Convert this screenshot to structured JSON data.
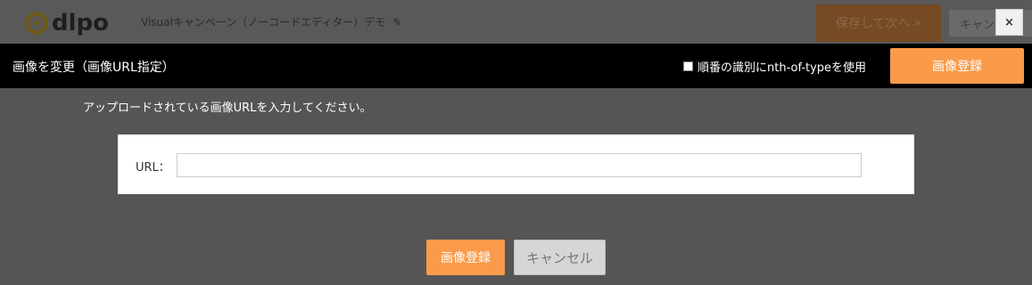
{
  "header": {
    "logo_text": "dlpo",
    "project_title": "Visualキャンペーン（ノーコードエディター）デモ",
    "save_next_label": "保存して次へ",
    "save_next_arrow": "»",
    "cancel_label": "キャンセル",
    "close_label": "×"
  },
  "dialog": {
    "title": "画像を変更（画像URL指定）",
    "nth_checkbox_label": "順番の識別にnth-of-typeを使用",
    "nth_checkbox_checked": false,
    "top_register_label": "画像登録",
    "instruction": "アップロードされている画像URLを入力してください。",
    "url_label": "URL：",
    "url_value": "",
    "register_label": "画像登録",
    "cancel_label": "キャンセル"
  },
  "colors": {
    "accent_orange": "#f99b4a",
    "overlay_gray": "#555555",
    "bar_black": "#000000"
  }
}
